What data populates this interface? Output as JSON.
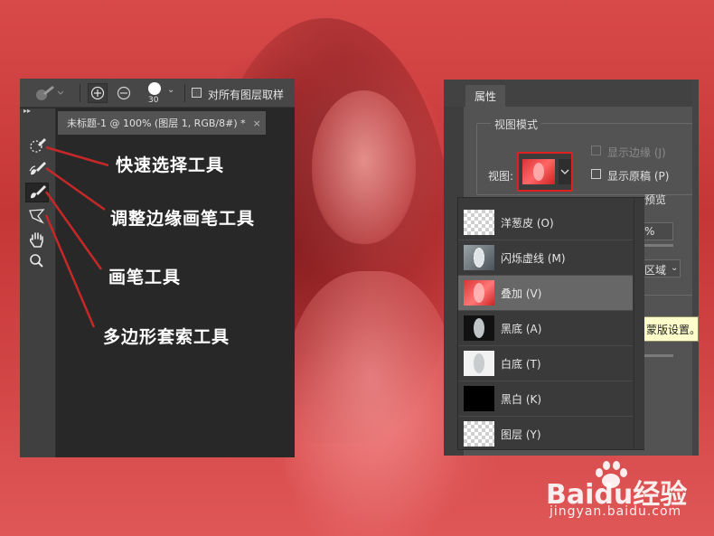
{
  "left_panel": {
    "options_bar": {
      "brush_size": "30",
      "sample_all_layers_label": "对所有图层取样"
    },
    "tool_strip_toggle": "▸▸",
    "document_tab": {
      "title": "未标题-1 @ 100% (图层 1, RGB/8#) *",
      "close": "×"
    },
    "tools": [
      {
        "name": "quick-selection-tool",
        "icon": "quick-selection-icon"
      },
      {
        "name": "refine-edge-brush-tool",
        "icon": "refine-edge-brush-icon"
      },
      {
        "name": "brush-tool",
        "icon": "brush-icon",
        "active": true
      },
      {
        "name": "polygonal-lasso-tool",
        "icon": "polygonal-lasso-icon"
      },
      {
        "name": "hand-tool",
        "icon": "hand-icon"
      },
      {
        "name": "zoom-tool",
        "icon": "zoom-icon"
      }
    ]
  },
  "annotations": {
    "quick_selection": "快速选择工具",
    "refine_edge_brush": "调整边缘画笔工具",
    "brush": "画笔工具",
    "polygonal_lasso": "多边形套索工具",
    "arrow_color": "#c62828"
  },
  "properties_panel": {
    "tab_label": "属性",
    "view_mode_title": "视图模式",
    "view_label": "视图:",
    "show_edge_label": "显示边缘 (J)",
    "show_original_label": "显示原稿 (P)",
    "preview_partial": "预览",
    "percent_partial": "%",
    "region_partial": "区域",
    "tooltip_partial": "蒙版设置。",
    "highlight_color": "#e02020"
  },
  "view_dropdown": {
    "items": [
      {
        "label": "洋葱皮 (O)",
        "thumb": "checker"
      },
      {
        "label": "闪烁虚线 (M)",
        "thumb": "photo-dashed"
      },
      {
        "label": "叠加 (V)",
        "thumb": "photo-red",
        "selected": true
      },
      {
        "label": "黑底 (A)",
        "thumb": "photo-black"
      },
      {
        "label": "白底 (T)",
        "thumb": "photo-white"
      },
      {
        "label": "黑白 (K)",
        "thumb": "black"
      },
      {
        "label": "图层 (Y)",
        "thumb": "checker"
      }
    ]
  },
  "watermark": {
    "brand": "Baidu经验",
    "url": "jingyan.baidu.com"
  }
}
